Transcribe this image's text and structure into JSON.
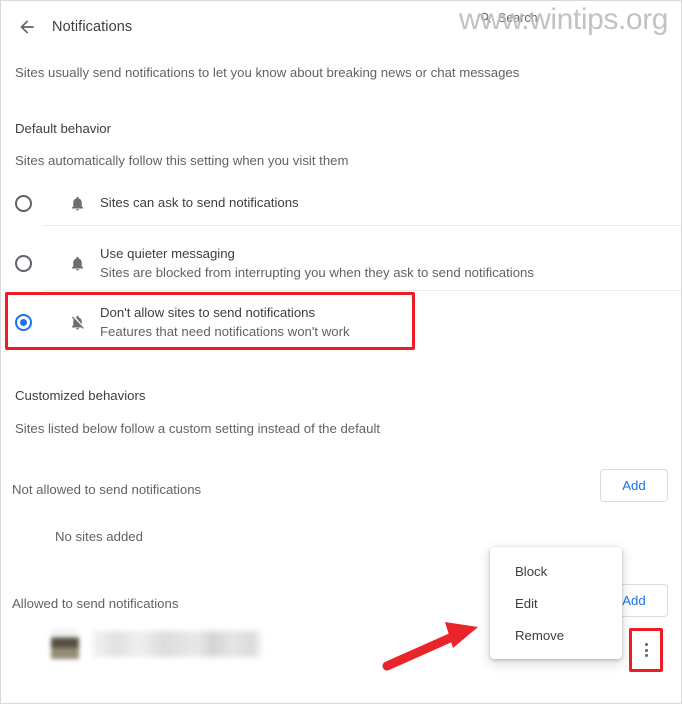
{
  "header": {
    "back_icon": "back-arrow-icon",
    "title": "Notifications",
    "search_label": "Search",
    "search_icon": "search-icon"
  },
  "watermark": {
    "text": "www.wintips.org"
  },
  "intro": {
    "text": "Sites usually send notifications to let you know about breaking news or chat messages"
  },
  "default_behavior": {
    "heading": "Default behavior",
    "subheading": "Sites automatically follow this setting when you visit them",
    "options": [
      {
        "id": "sites-can-ask",
        "icon": "bell-icon",
        "primary": "Sites can ask to send notifications",
        "secondary": "",
        "selected": false
      },
      {
        "id": "quieter-messaging",
        "icon": "bell-icon",
        "primary": "Use quieter messaging",
        "secondary": "Sites are blocked from interrupting you when they ask to send notifications",
        "selected": false
      },
      {
        "id": "dont-allow",
        "icon": "bell-off-icon",
        "primary": "Don't allow sites to send notifications",
        "secondary": "Features that need notifications won't work",
        "selected": true
      }
    ]
  },
  "customized_behaviors": {
    "heading": "Customized behaviors",
    "subheading": "Sites listed below follow a custom setting instead of the default",
    "not_allowed": {
      "label": "Not allowed to send notifications",
      "add_label": "Add",
      "empty_text": "No sites added"
    },
    "allowed": {
      "label": "Allowed to send notifications",
      "add_label": "Add",
      "add_label_clipped": "dd",
      "site_row": {
        "favicon": "blurred-favicon",
        "site_name": ""
      },
      "overflow_icon": "three-dot-menu-icon"
    }
  },
  "context_menu": {
    "items": [
      {
        "label": "Block"
      },
      {
        "label": "Edit"
      },
      {
        "label": "Remove"
      }
    ]
  },
  "annotations": {
    "highlight_color": "#ee1c25",
    "arrow_color": "#e8252a",
    "accent_color": "#1a73e8"
  }
}
